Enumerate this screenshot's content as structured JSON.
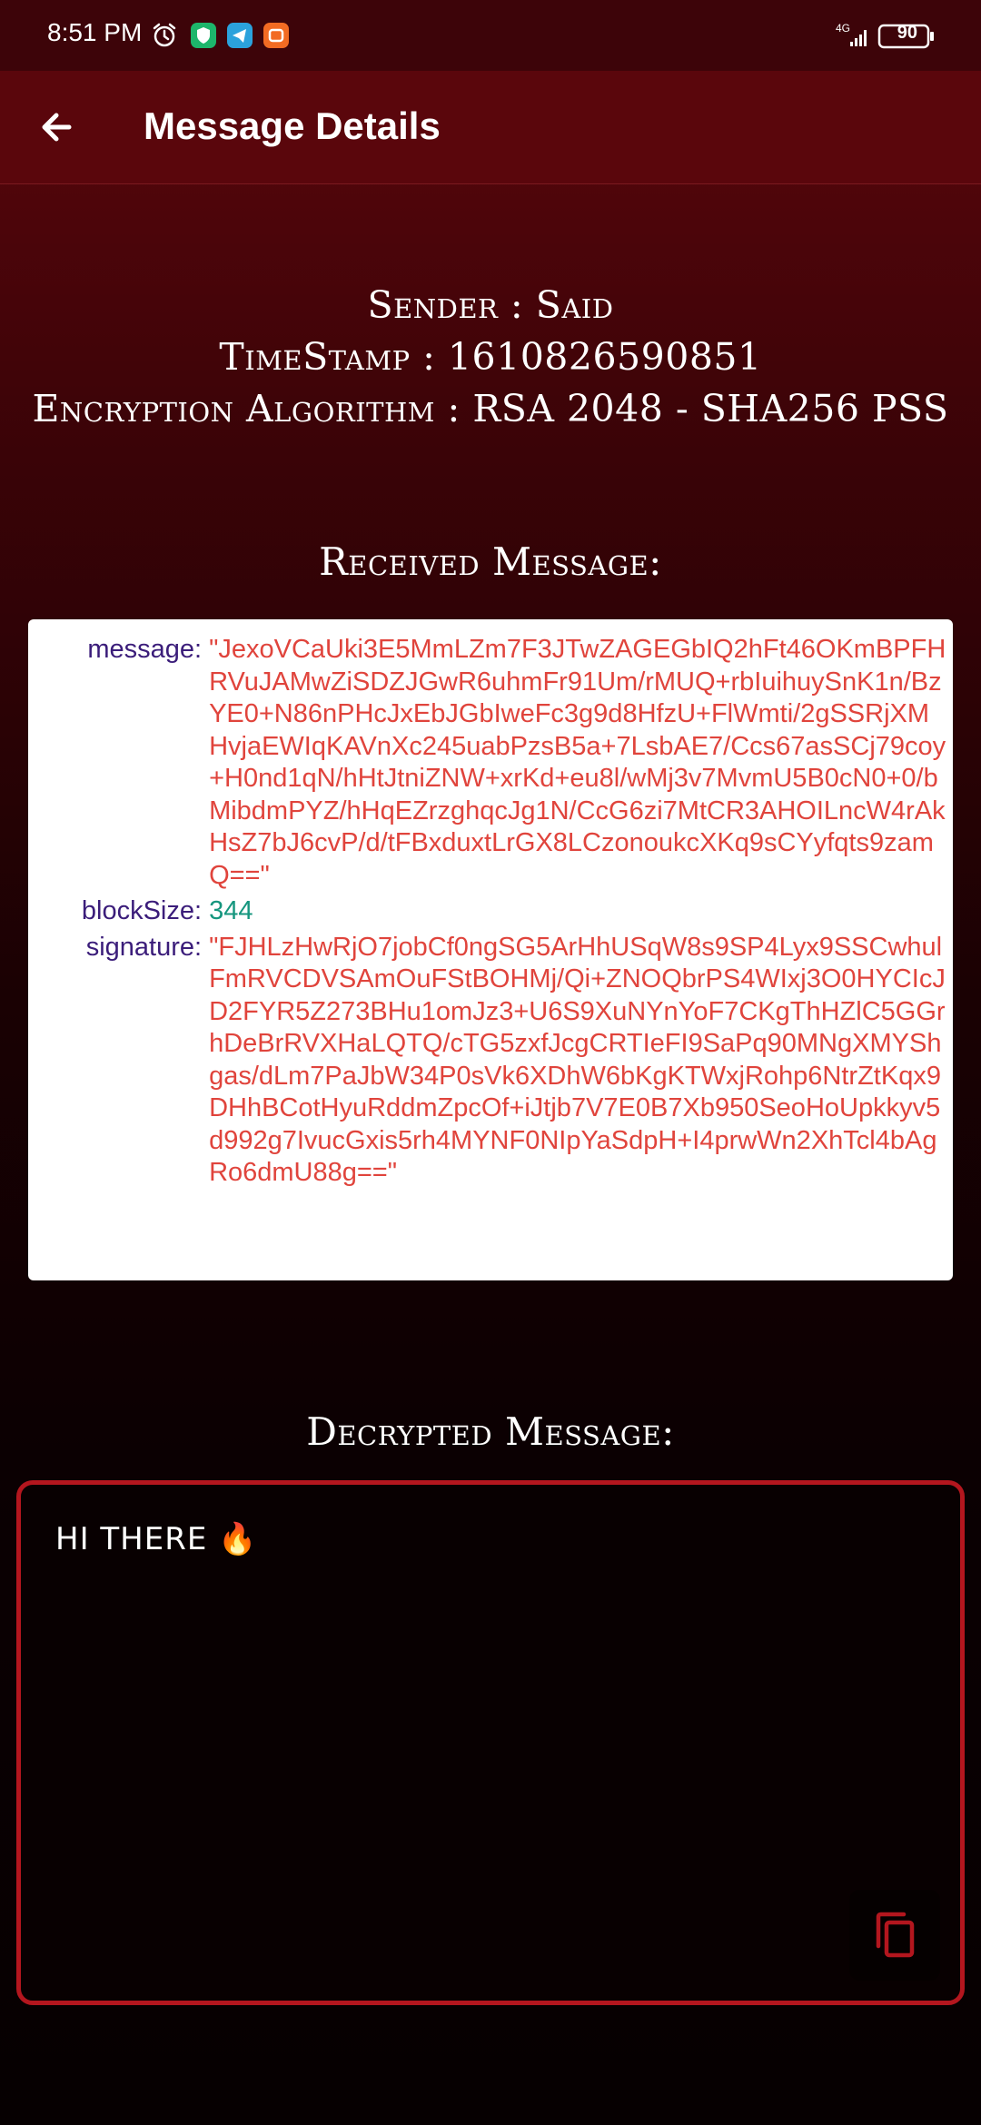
{
  "status_bar": {
    "time": "8:51 PM",
    "network": "4G",
    "battery": "90",
    "icons": [
      "alarm-icon",
      "shield-app-icon",
      "telegram-icon",
      "app-notification-icon",
      "signal-icon",
      "battery-icon"
    ]
  },
  "app_bar": {
    "title": "Message Details",
    "back_icon": "arrow-left-icon"
  },
  "info": {
    "sender": "Sender : Said",
    "timestamp": "TimeStamp : 1610826590851",
    "algorithm": "Encryption Algorithm : RSA 2048 - SHA256 PSS"
  },
  "received": {
    "heading": "Received Message:",
    "message_key": "message",
    "message_value": "\"JexoVCaUki3E5MmLZm7F3JTwZAGEGbIQ2hFt46OKmBPFHRVuJAMwZiSDZJGwR6uhmFr91Um/rMUQ+rbIuihuySnK1n/BzYE0+N86nPHcJxEbJGbIweFc3g9d8HfzU+FlWmti/2gSSRjXMHvjaEWIqKAVnXc245uabPzsB5a+7LsbAE7/Ccs67asSCj79coy+H0nd1qN/hHtJtniZNW+xrKd+eu8l/wMj3v7MvmU5B0cN0+0/bMibdmPYZ/hHqEZrzghqcJg1N/CcG6zi7MtCR3AHOILncW4rAkHsZ7bJ6cvP/d/tFBxduxtLrGX8LCzonoukcXKq9sCYyfqts9zamQ==\"",
    "block_key": "blockSize",
    "block_value": "344",
    "signature_key": "signature",
    "signature_value": "\"FJHLzHwRjO7jobCf0ngSG5ArHhUSqW8s9SP4Lyx9SSCwhulFmRVCDVSAmOuFStBOHMj/Qi+ZNOQbrPS4WIxj3O0HYCIcJD2FYR5Z273BHu1omJz3+U6S9XuNYnYoF7CKgThHZlC5GGrhDeBrRVXHaLQTQ/cTG5zxfJcgCRTIeFI9SaPq90MNgXMYShgas/dLm7PaJbW34P0sVk6XDhW6bKgKTWxjRohp6NtrZtKqx9DHhBCotHyuRddmZpcOf+iJtjb7V7E0B7Xb950SeoHoUpkkyv5d992g7IvucGxis5rh4MYNF0NIpYaSdpH+I4prwWn2XhTcl4bAgRo6dmU88g==\""
  },
  "decrypted": {
    "heading": "Decrypted Message:",
    "text": "HI THERE 🔥",
    "copy_icon": "copy-icon"
  },
  "colors": {
    "app_bar": "#5a060c",
    "border": "#b3161e",
    "key_text": "#3b1d7a",
    "string_text": "#e0443c",
    "number_text": "#15967e"
  }
}
